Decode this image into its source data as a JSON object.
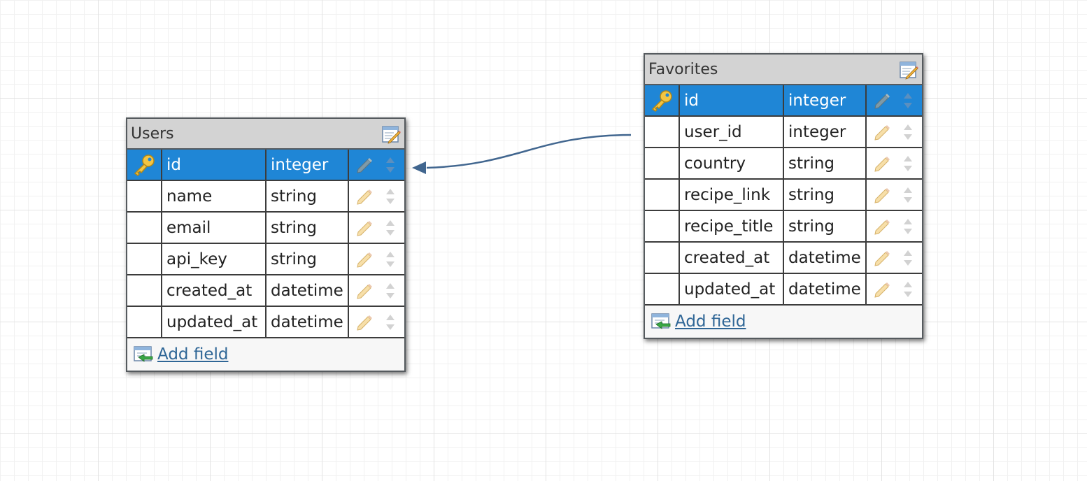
{
  "colors": {
    "primary_row": "#1f86d6",
    "header_bg": "#d3d3d3",
    "link": "#2f6696",
    "connector": "#41668f"
  },
  "icons": {
    "primary_key": "key-icon",
    "edit_table": "edit-table-icon",
    "edit_field": "pencil-icon",
    "reorder": "sort-arrows-icon",
    "add_field": "add-field-icon"
  },
  "relationship": {
    "from": "Favorites.user_id",
    "to": "Users.id"
  },
  "tables": [
    {
      "name": "Users",
      "fields": [
        {
          "name": "id",
          "type": "integer",
          "primary": true
        },
        {
          "name": "name",
          "type": "string",
          "primary": false
        },
        {
          "name": "email",
          "type": "string",
          "primary": false
        },
        {
          "name": "api_key",
          "type": "string",
          "primary": false
        },
        {
          "name": "created_at",
          "type": "datetime",
          "primary": false
        },
        {
          "name": "updated_at",
          "type": "datetime",
          "primary": false
        }
      ],
      "add_field_label": "Add field"
    },
    {
      "name": "Favorites",
      "fields": [
        {
          "name": "id",
          "type": "integer",
          "primary": true
        },
        {
          "name": "user_id",
          "type": "integer",
          "primary": false
        },
        {
          "name": "country",
          "type": "string",
          "primary": false
        },
        {
          "name": "recipe_link",
          "type": "string",
          "primary": false
        },
        {
          "name": "recipe_title",
          "type": "string",
          "primary": false
        },
        {
          "name": "created_at",
          "type": "datetime",
          "primary": false
        },
        {
          "name": "updated_at",
          "type": "datetime",
          "primary": false
        }
      ],
      "add_field_label": "Add field"
    }
  ]
}
